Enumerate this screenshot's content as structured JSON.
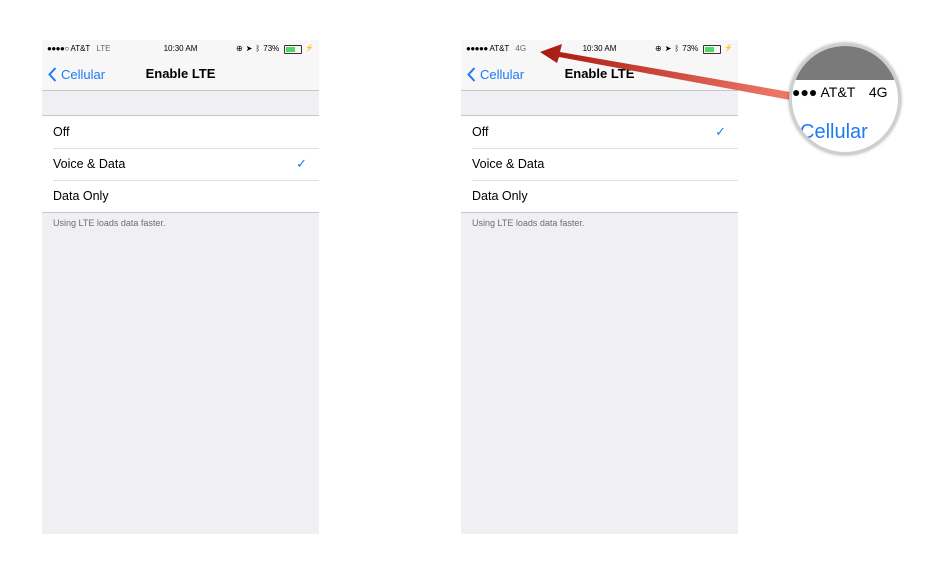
{
  "left": {
    "status": {
      "signal": "●●●●○",
      "carrier": "AT&T",
      "network": "LTE",
      "time": "10:30 AM",
      "battery": "73%",
      "battery_level": 0.73
    },
    "nav": {
      "back_label": "Cellular",
      "title": "Enable LTE"
    },
    "options": [
      {
        "label": "Off",
        "checked": false
      },
      {
        "label": "Voice & Data",
        "checked": true
      },
      {
        "label": "Data Only",
        "checked": false
      }
    ],
    "footer": "Using LTE loads data faster."
  },
  "right": {
    "status": {
      "signal": "●●●●●",
      "carrier": "AT&T",
      "network": "4G",
      "time": "10:30 AM",
      "battery": "73%",
      "battery_level": 0.73
    },
    "nav": {
      "back_label": "Cellular",
      "title": "Enable LTE"
    },
    "options": [
      {
        "label": "Off",
        "checked": true
      },
      {
        "label": "Voice & Data",
        "checked": false
      },
      {
        "label": "Data Only",
        "checked": false
      }
    ],
    "footer": "Using LTE loads data faster."
  },
  "magnifier": {
    "signal": "●●●",
    "carrier": "AT&T",
    "network": "4G",
    "back_label": "Cellular"
  },
  "colors": {
    "accent": "#1d7bf3",
    "arrow": "#b3261e",
    "background": "#efeff4",
    "battery": "#4cd964"
  },
  "icons": {
    "back": "chevron-left-icon",
    "check": "checkmark-icon",
    "location": "location-arrow-icon",
    "bluetooth": "bluetooth-icon",
    "alarm": "alarm-icon",
    "battery": "battery-icon"
  }
}
